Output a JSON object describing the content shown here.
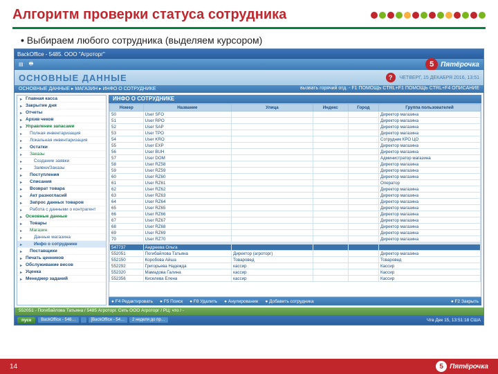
{
  "slide": {
    "title": "Алгоритм проверки статуса сотрудника",
    "bullet": "Выбираем любого сотрудника (выделяем курсором)",
    "page_number": "14"
  },
  "dot_colors": [
    "#c1262d",
    "#7ab51d",
    "#c1262d",
    "#7ab51d",
    "#fbb040",
    "#c1262d",
    "#7ab51d",
    "#c1262d",
    "#7ab51d",
    "#fbb040",
    "#c1262d",
    "#7ab51d",
    "#c1262d",
    "#7ab51d"
  ],
  "app": {
    "titlebar": "BackOffice - 5485. ООО \"Агроторг\"",
    "brand": "Пятёрочка",
    "banner_title": "ОСНОВНЫЕ ДАННЫЕ",
    "date_txt": "ЧЕТВЕРГ, 15 ДЕКАБРЯ 2016, 13:51",
    "help_hint": "вызвать горячий отд. - F1 ПОМОЩЬ  CTRL+F1 ПОМОЩЬ  CTRL+F4 ОПИСАНИЕ",
    "breadcrumb": "ОСНОВНЫЕ ДАННЫЕ  ▸  МАГАЗИН  ▸  ИНФО О СОТРУДНИКЕ",
    "content_title": "ИНФО О СОТРУДНИКЕ",
    "status": "552051 - Погибайлова Татьяна / 5485 Агроторг. Сеть ООО Агроторг / РЦ: что / -",
    "columns": [
      "Номер",
      "Название",
      "Улица",
      "Индекс",
      "Город",
      "Группа пользователей"
    ],
    "sidebar": [
      {
        "t": "Главная касса",
        "b": 1
      },
      {
        "t": "Закрытие дня",
        "b": 1
      },
      {
        "t": "Отчеты",
        "b": 1
      },
      {
        "t": "Архив чеков",
        "b": 1
      },
      {
        "t": "Управление запасами",
        "b": 1,
        "g": 1
      },
      {
        "t": "Полная инвентаризация",
        "c": 1
      },
      {
        "t": "Локальная инвентаризация",
        "c": 1
      },
      {
        "t": "Остатки",
        "c": 1,
        "b": 1
      },
      {
        "t": "Заказы",
        "c": 1,
        "g": 1
      },
      {
        "t": "Создание заявки",
        "c2": 1
      },
      {
        "t": "Заявки/Заказы",
        "c2": 1
      },
      {
        "t": "Поступления",
        "c": 1,
        "b": 1
      },
      {
        "t": "Списания",
        "c": 1,
        "b": 1
      },
      {
        "t": "Возврат товара",
        "c": 1,
        "b": 1
      },
      {
        "t": "Акт разногласий",
        "c": 1,
        "b": 1
      },
      {
        "t": "Запрос данных товаров",
        "c": 1,
        "b": 1
      },
      {
        "t": "Работа с данными о контрагент",
        "c": 1
      },
      {
        "t": "Основные данные",
        "b": 1,
        "g": 1
      },
      {
        "t": "Товары",
        "c": 1,
        "b": 1
      },
      {
        "t": "Магазин",
        "c": 1,
        "g": 1
      },
      {
        "t": "Данные магазина",
        "c2": 1
      },
      {
        "t": "Инфо о сотруднике",
        "c2": 1,
        "hl": 1
      },
      {
        "t": "Поставщики",
        "c": 1,
        "b": 1
      },
      {
        "t": "Печать ценников",
        "b": 1
      },
      {
        "t": "Обслуживание весов",
        "b": 1
      },
      {
        "t": "Уценка",
        "b": 1
      },
      {
        "t": "Менеджер заданий",
        "b": 1
      }
    ],
    "rows_top": [
      {
        "n": "50",
        "name": "User SFO",
        "g": "Директор магазина"
      },
      {
        "n": "51",
        "name": "User RPO",
        "g": "Директор магазина"
      },
      {
        "n": "52",
        "name": "User SAP",
        "g": "Директор магазина"
      },
      {
        "n": "53",
        "name": "User TPO",
        "g": "Директор магазина"
      },
      {
        "n": "54",
        "name": "User KRO",
        "g": "Сотрудник КРО ЦО"
      },
      {
        "n": "55",
        "name": "User EXP",
        "g": "Директор магазина"
      },
      {
        "n": "56",
        "name": "User BUH",
        "g": "Директор магазина"
      },
      {
        "n": "57",
        "name": "User DOM",
        "g": "Администратор магазина"
      },
      {
        "n": "58",
        "name": "User RZ58",
        "g": "Директор магазина"
      },
      {
        "n": "59",
        "name": "User RZ59",
        "g": "Директор магазина"
      },
      {
        "n": "60",
        "name": "User RZ60",
        "g": "Директор магазина"
      },
      {
        "n": "61",
        "name": "User RZ61",
        "g": "Оператор"
      },
      {
        "n": "62",
        "name": "User RZ62",
        "g": "Директор магазина"
      },
      {
        "n": "63",
        "name": "User RZ63",
        "g": "Директор магазина"
      },
      {
        "n": "64",
        "name": "User RZ64",
        "g": "Директор магазина"
      },
      {
        "n": "65",
        "name": "User RZ65",
        "g": "Директор магазина"
      },
      {
        "n": "66",
        "name": "User RZ66",
        "g": "Директор магазина"
      },
      {
        "n": "67",
        "name": "User RZ67",
        "g": "Директор магазина"
      },
      {
        "n": "68",
        "name": "User RZ68",
        "g": "Директор магазина"
      },
      {
        "n": "69",
        "name": "User RZ69",
        "g": "Директор магазина"
      },
      {
        "n": "70",
        "name": "User RZ70",
        "g": "Директор магазина"
      }
    ],
    "rows_bottom": [
      {
        "n": "547737",
        "name": "Андреева Ольга",
        "p": "",
        "g": "",
        "sel": 1
      },
      {
        "n": "552051",
        "name": "Погибайлова Татьяна",
        "p": "Директор (агроторг)",
        "g": "Директор магазина"
      },
      {
        "n": "552150",
        "name": "Коробова Айша",
        "p": "Товаровед",
        "g": "Товаровед"
      },
      {
        "n": "552292",
        "name": "Григорьева Надежда",
        "p": "кассир",
        "g": "Кассир"
      },
      {
        "n": "552320",
        "name": "Мамадова Галина",
        "p": "кассир",
        "g": "Кассир"
      },
      {
        "n": "552356",
        "name": "Киселева Елена",
        "p": "кассир",
        "g": "Кассир"
      }
    ],
    "btnbar": [
      "● F4  Редактировать",
      "● F5  Поиск",
      "● F8  Удалить",
      "● Анулирование",
      "● Добавить сотрудника"
    ],
    "btnbar_right": "● F2  Закрыть",
    "taskbar": {
      "start": "пуск",
      "items": [
        "BackOffice - 548…",
        "",
        "[BackOffice - 54…",
        "2 неделя до пр…"
      ],
      "tray": "Чтв Дек 15, 13:51:18  США"
    }
  },
  "footer_brand": "Пятёрочка"
}
